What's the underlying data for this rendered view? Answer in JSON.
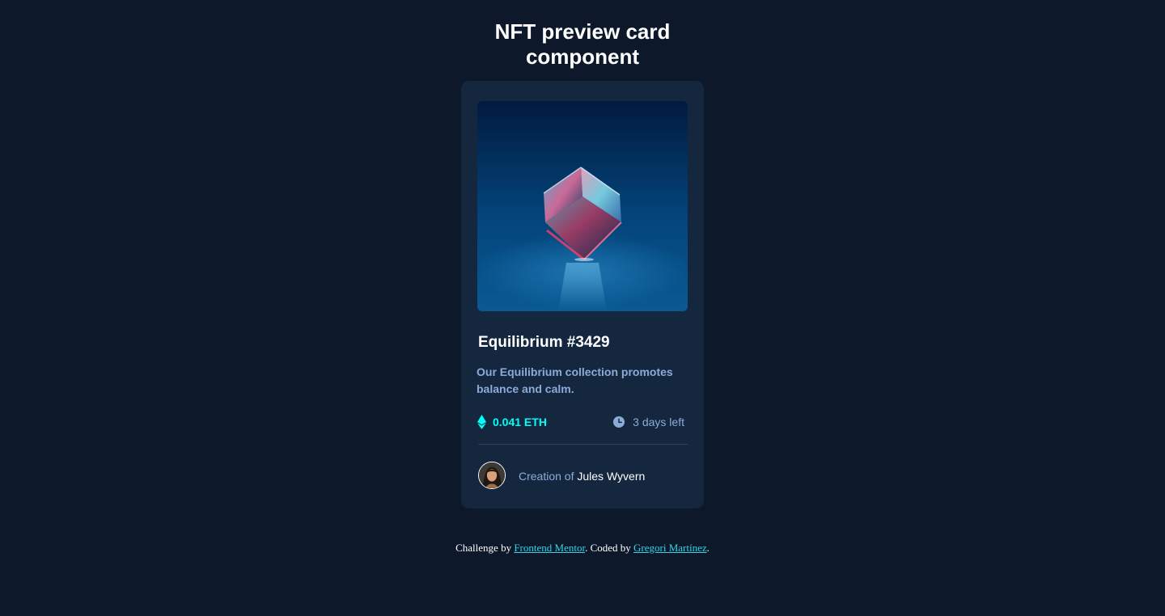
{
  "page": {
    "title_line1": "NFT preview card",
    "title_line2": "component"
  },
  "card": {
    "image_icon": "crystal-cube-image",
    "title": "Equilibrium #3429",
    "description": "Our Equilibrium collection promotes balance and calm.",
    "price": {
      "icon": "ethereum-icon",
      "value": "0.041 ETH"
    },
    "time_left": {
      "icon": "clock-icon",
      "text": "3 days left"
    },
    "creator": {
      "avatar_icon": "avatar",
      "prefix": "Creation of",
      "name": "Jules Wyvern"
    }
  },
  "footer": {
    "prefix": "Challenge by ",
    "link1": "Frontend Mentor",
    "middle": ". Coded by ",
    "link2": "Gregori Martínez",
    "suffix": "."
  },
  "colors": {
    "background": "#0d192b",
    "card": "#15263f",
    "cyan": "#00fff8",
    "soft_blue": "#8bacd9",
    "white": "#ffffff"
  }
}
